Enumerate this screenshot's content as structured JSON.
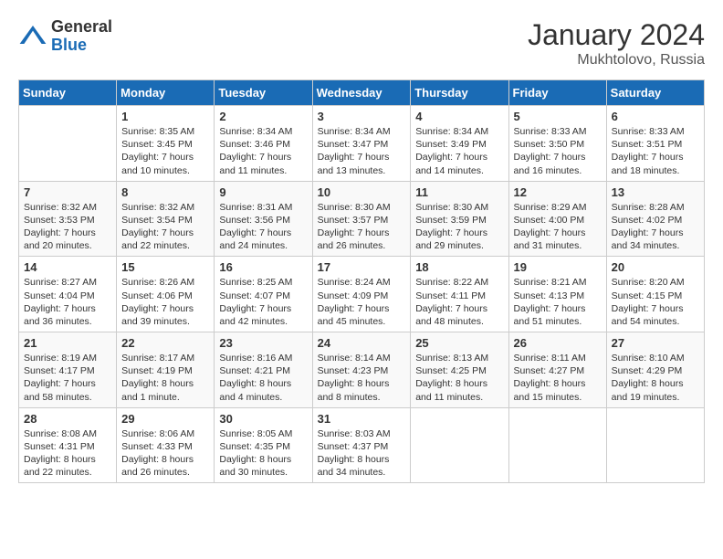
{
  "logo": {
    "general": "General",
    "blue": "Blue"
  },
  "header": {
    "month": "January 2024",
    "location": "Mukhtolovo, Russia"
  },
  "weekdays": [
    "Sunday",
    "Monday",
    "Tuesday",
    "Wednesday",
    "Thursday",
    "Friday",
    "Saturday"
  ],
  "weeks": [
    [
      {
        "day": "",
        "sunrise": "",
        "sunset": "",
        "daylight": ""
      },
      {
        "day": "1",
        "sunrise": "Sunrise: 8:35 AM",
        "sunset": "Sunset: 3:45 PM",
        "daylight": "Daylight: 7 hours and 10 minutes."
      },
      {
        "day": "2",
        "sunrise": "Sunrise: 8:34 AM",
        "sunset": "Sunset: 3:46 PM",
        "daylight": "Daylight: 7 hours and 11 minutes."
      },
      {
        "day": "3",
        "sunrise": "Sunrise: 8:34 AM",
        "sunset": "Sunset: 3:47 PM",
        "daylight": "Daylight: 7 hours and 13 minutes."
      },
      {
        "day": "4",
        "sunrise": "Sunrise: 8:34 AM",
        "sunset": "Sunset: 3:49 PM",
        "daylight": "Daylight: 7 hours and 14 minutes."
      },
      {
        "day": "5",
        "sunrise": "Sunrise: 8:33 AM",
        "sunset": "Sunset: 3:50 PM",
        "daylight": "Daylight: 7 hours and 16 minutes."
      },
      {
        "day": "6",
        "sunrise": "Sunrise: 8:33 AM",
        "sunset": "Sunset: 3:51 PM",
        "daylight": "Daylight: 7 hours and 18 minutes."
      }
    ],
    [
      {
        "day": "7",
        "sunrise": "Sunrise: 8:32 AM",
        "sunset": "Sunset: 3:53 PM",
        "daylight": "Daylight: 7 hours and 20 minutes."
      },
      {
        "day": "8",
        "sunrise": "Sunrise: 8:32 AM",
        "sunset": "Sunset: 3:54 PM",
        "daylight": "Daylight: 7 hours and 22 minutes."
      },
      {
        "day": "9",
        "sunrise": "Sunrise: 8:31 AM",
        "sunset": "Sunset: 3:56 PM",
        "daylight": "Daylight: 7 hours and 24 minutes."
      },
      {
        "day": "10",
        "sunrise": "Sunrise: 8:30 AM",
        "sunset": "Sunset: 3:57 PM",
        "daylight": "Daylight: 7 hours and 26 minutes."
      },
      {
        "day": "11",
        "sunrise": "Sunrise: 8:30 AM",
        "sunset": "Sunset: 3:59 PM",
        "daylight": "Daylight: 7 hours and 29 minutes."
      },
      {
        "day": "12",
        "sunrise": "Sunrise: 8:29 AM",
        "sunset": "Sunset: 4:00 PM",
        "daylight": "Daylight: 7 hours and 31 minutes."
      },
      {
        "day": "13",
        "sunrise": "Sunrise: 8:28 AM",
        "sunset": "Sunset: 4:02 PM",
        "daylight": "Daylight: 7 hours and 34 minutes."
      }
    ],
    [
      {
        "day": "14",
        "sunrise": "Sunrise: 8:27 AM",
        "sunset": "Sunset: 4:04 PM",
        "daylight": "Daylight: 7 hours and 36 minutes."
      },
      {
        "day": "15",
        "sunrise": "Sunrise: 8:26 AM",
        "sunset": "Sunset: 4:06 PM",
        "daylight": "Daylight: 7 hours and 39 minutes."
      },
      {
        "day": "16",
        "sunrise": "Sunrise: 8:25 AM",
        "sunset": "Sunset: 4:07 PM",
        "daylight": "Daylight: 7 hours and 42 minutes."
      },
      {
        "day": "17",
        "sunrise": "Sunrise: 8:24 AM",
        "sunset": "Sunset: 4:09 PM",
        "daylight": "Daylight: 7 hours and 45 minutes."
      },
      {
        "day": "18",
        "sunrise": "Sunrise: 8:22 AM",
        "sunset": "Sunset: 4:11 PM",
        "daylight": "Daylight: 7 hours and 48 minutes."
      },
      {
        "day": "19",
        "sunrise": "Sunrise: 8:21 AM",
        "sunset": "Sunset: 4:13 PM",
        "daylight": "Daylight: 7 hours and 51 minutes."
      },
      {
        "day": "20",
        "sunrise": "Sunrise: 8:20 AM",
        "sunset": "Sunset: 4:15 PM",
        "daylight": "Daylight: 7 hours and 54 minutes."
      }
    ],
    [
      {
        "day": "21",
        "sunrise": "Sunrise: 8:19 AM",
        "sunset": "Sunset: 4:17 PM",
        "daylight": "Daylight: 7 hours and 58 minutes."
      },
      {
        "day": "22",
        "sunrise": "Sunrise: 8:17 AM",
        "sunset": "Sunset: 4:19 PM",
        "daylight": "Daylight: 8 hours and 1 minute."
      },
      {
        "day": "23",
        "sunrise": "Sunrise: 8:16 AM",
        "sunset": "Sunset: 4:21 PM",
        "daylight": "Daylight: 8 hours and 4 minutes."
      },
      {
        "day": "24",
        "sunrise": "Sunrise: 8:14 AM",
        "sunset": "Sunset: 4:23 PM",
        "daylight": "Daylight: 8 hours and 8 minutes."
      },
      {
        "day": "25",
        "sunrise": "Sunrise: 8:13 AM",
        "sunset": "Sunset: 4:25 PM",
        "daylight": "Daylight: 8 hours and 11 minutes."
      },
      {
        "day": "26",
        "sunrise": "Sunrise: 8:11 AM",
        "sunset": "Sunset: 4:27 PM",
        "daylight": "Daylight: 8 hours and 15 minutes."
      },
      {
        "day": "27",
        "sunrise": "Sunrise: 8:10 AM",
        "sunset": "Sunset: 4:29 PM",
        "daylight": "Daylight: 8 hours and 19 minutes."
      }
    ],
    [
      {
        "day": "28",
        "sunrise": "Sunrise: 8:08 AM",
        "sunset": "Sunset: 4:31 PM",
        "daylight": "Daylight: 8 hours and 22 minutes."
      },
      {
        "day": "29",
        "sunrise": "Sunrise: 8:06 AM",
        "sunset": "Sunset: 4:33 PM",
        "daylight": "Daylight: 8 hours and 26 minutes."
      },
      {
        "day": "30",
        "sunrise": "Sunrise: 8:05 AM",
        "sunset": "Sunset: 4:35 PM",
        "daylight": "Daylight: 8 hours and 30 minutes."
      },
      {
        "day": "31",
        "sunrise": "Sunrise: 8:03 AM",
        "sunset": "Sunset: 4:37 PM",
        "daylight": "Daylight: 8 hours and 34 minutes."
      },
      {
        "day": "",
        "sunrise": "",
        "sunset": "",
        "daylight": ""
      },
      {
        "day": "",
        "sunrise": "",
        "sunset": "",
        "daylight": ""
      },
      {
        "day": "",
        "sunrise": "",
        "sunset": "",
        "daylight": ""
      }
    ]
  ]
}
